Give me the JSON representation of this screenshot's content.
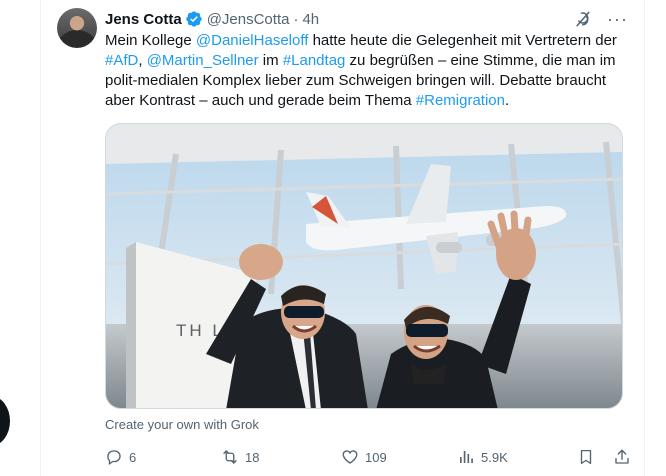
{
  "post": {
    "author_name": "Jens Cotta",
    "handle": "@JensCotta",
    "separator": "·",
    "time": "4h",
    "text_segments": [
      {
        "text": "Mein Kollege ",
        "link": false
      },
      {
        "text": "@DanielHaseloff",
        "link": true
      },
      {
        "text": "  hatte heute die Gelegenheit mit Vertretern der ",
        "link": false
      },
      {
        "text": "#AfD",
        "link": true
      },
      {
        "text": ", ",
        "link": false
      },
      {
        "text": "@Martin_Sellner",
        "link": true
      },
      {
        "text": " im ",
        "link": false
      },
      {
        "text": "#Landtag",
        "link": true
      },
      {
        "text": " zu begrüßen – eine Stimme, die man im polit-medialen Komplex lieber zum Schweigen bringen will. Debatte braucht aber Kontrast – auch und gerade beim Thema ",
        "link": false
      },
      {
        "text": "#Remigration",
        "link": true
      },
      {
        "text": ".",
        "link": false
      }
    ],
    "media_sign_text": "TH LAN",
    "grok_link": "Create your own with Grok"
  },
  "actions": {
    "replies": "6",
    "reposts": "18",
    "likes": "109",
    "views": "5.9K"
  },
  "colors": {
    "link": "#1d9bf0",
    "verified": "#1d9bf0",
    "secondary_text": "#536471",
    "primary_text": "#0f1419"
  },
  "icons": [
    "verified-badge-icon",
    "grok-icon",
    "more-icon",
    "reply-icon",
    "repost-icon",
    "like-icon",
    "views-icon",
    "bookmark-icon",
    "share-icon"
  ]
}
